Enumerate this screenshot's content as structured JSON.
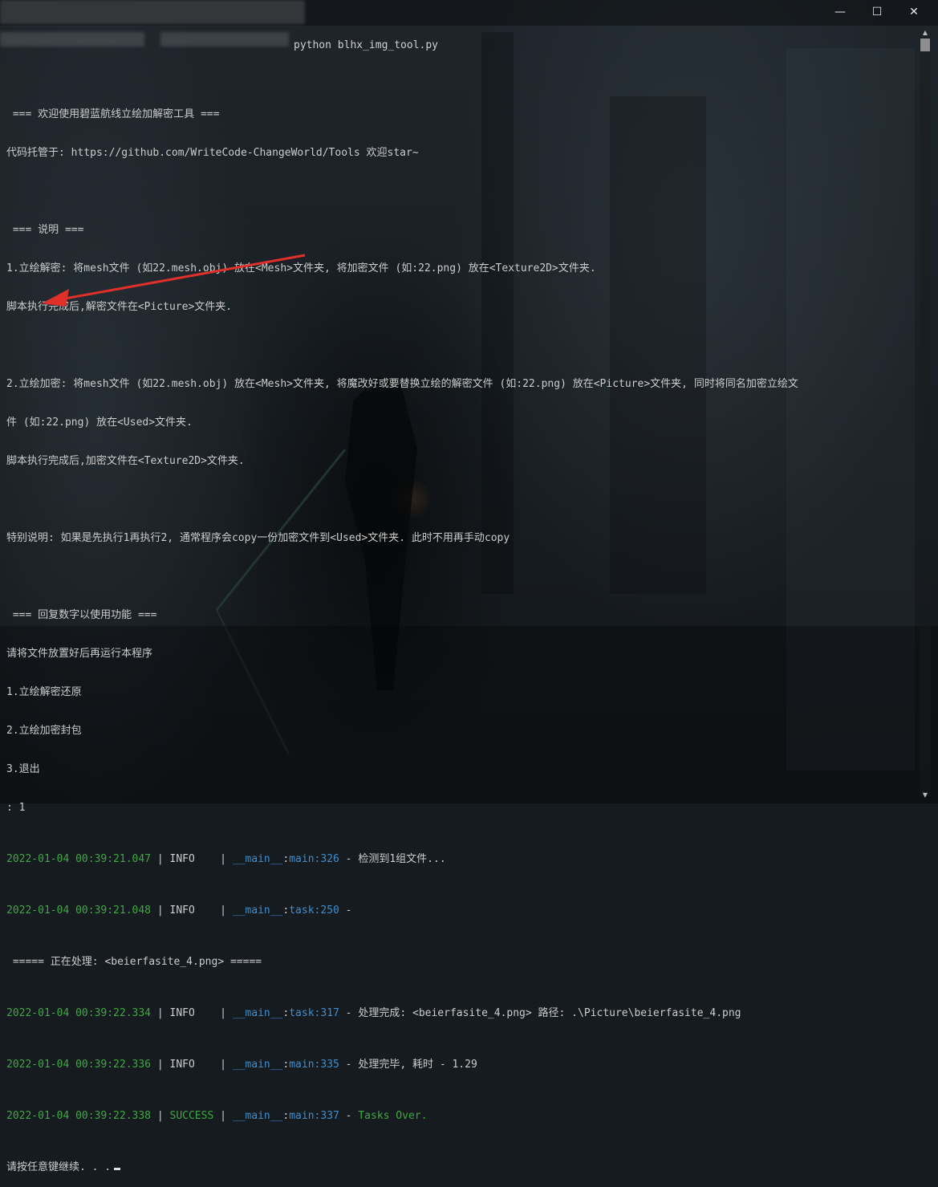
{
  "window": {
    "command": "python blhx_img_tool.py",
    "minimize_glyph": "—",
    "maximize_glyph": "☐",
    "close_glyph": "✕"
  },
  "terminal": {
    "lines": [
      " === 欢迎使用碧蓝航线立绘加解密工具 ===",
      "代码托管于: https://github.com/WriteCode-ChangeWorld/Tools 欢迎star~",
      "",
      " === 说明 ===",
      "1.立绘解密: 将mesh文件 (如22.mesh.obj) 放在<Mesh>文件夹, 将加密文件 (如:22.png) 放在<Texture2D>文件夹.",
      "脚本执行完成后,解密文件在<Picture>文件夹.",
      "",
      "2.立绘加密: 将mesh文件 (如22.mesh.obj) 放在<Mesh>文件夹, 将魔改好或要替换立绘的解密文件 (如:22.png) 放在<Picture>文件夹, 同时将同名加密立绘文",
      "件 (如:22.png) 放在<Used>文件夹.",
      "脚本执行完成后,加密文件在<Texture2D>文件夹.",
      "",
      "特别说明: 如果是先执行1再执行2, 通常程序会copy一份加密文件到<Used>文件夹. 此时不用再手动copy",
      "",
      " === 回复数字以使用功能 ===",
      "请将文件放置好后再运行本程序",
      "1.立绘解密还原",
      "2.立绘加密封包",
      "3.退出",
      ": 1"
    ],
    "logs": [
      {
        "ts": "2022-01-04 00:39:21.047",
        "sep1": " | ",
        "level": "INFO   ",
        "sep2": " | ",
        "mod": "__main__",
        "colon": ":",
        "func": "main",
        "line": ":326",
        "msg": " - 检测到1组文件..."
      },
      {
        "ts": "2022-01-04 00:39:21.048",
        "sep1": " | ",
        "level": "INFO   ",
        "sep2": " | ",
        "mod": "__main__",
        "colon": ":",
        "func": "task",
        "line": ":250",
        "msg": " - "
      }
    ],
    "processing_line": " ===== 正在处理: <beierfasite_4.png> =====",
    "logs2": [
      {
        "ts": "2022-01-04 00:39:22.334",
        "sep1": " | ",
        "level": "INFO   ",
        "sep2": " | ",
        "mod": "__main__",
        "colon": ":",
        "func": "task",
        "line": ":317",
        "msg": " - 处理完成: <beierfasite_4.png> 路径: .\\Picture\\beierfasite_4.png"
      },
      {
        "ts": "2022-01-04 00:39:22.336",
        "sep1": " | ",
        "level": "INFO   ",
        "sep2": " | ",
        "mod": "__main__",
        "colon": ":",
        "func": "main",
        "line": ":335",
        "msg": " - 处理完毕, 耗时 - 1.29"
      }
    ],
    "success_log": {
      "ts": "2022-01-04 00:39:22.338",
      "sep1": " | ",
      "level": "SUCCESS",
      "sep2": " | ",
      "mod": "__main__",
      "colon": ":",
      "func": "main",
      "line": ":337",
      "dash": " - ",
      "msg": "Tasks Over."
    },
    "prompt": "请按任意键继续. . ."
  },
  "colors": {
    "timestamp": "#3fa842",
    "module": "#3e8ed0",
    "success": "#3fa842",
    "text": "#cccccc",
    "annotation_arrow": "#e0302a"
  }
}
